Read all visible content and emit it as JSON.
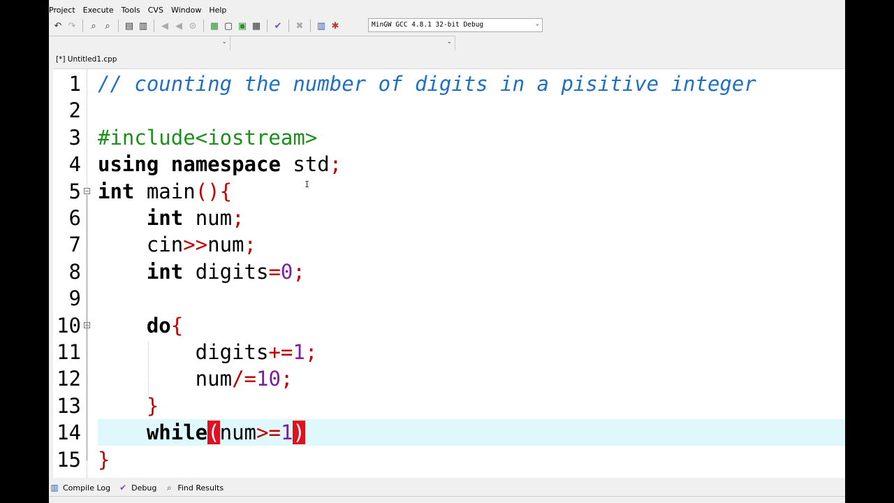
{
  "menu": [
    "Project",
    "Execute",
    "Tools",
    "CVS",
    "Window",
    "Help"
  ],
  "toolbar": {
    "compiler_selected": "MinGW GCC 4.8.1 32-bit Debug"
  },
  "tab": {
    "label": "[*] Untitled1.cpp"
  },
  "editor": {
    "lines": [
      {
        "n": "1",
        "tokens": [
          {
            "t": "// counting the number of digits in a pisitive integer",
            "c": "cm"
          }
        ]
      },
      {
        "n": "2",
        "tokens": []
      },
      {
        "n": "3",
        "tokens": [
          {
            "t": "#include<iostream>",
            "c": "pp"
          }
        ]
      },
      {
        "n": "4",
        "tokens": [
          {
            "t": "using",
            "c": "kw"
          },
          {
            "t": " "
          },
          {
            "t": "namespace",
            "c": "kw"
          },
          {
            "t": " std"
          },
          {
            "t": ";",
            "c": "sym"
          }
        ]
      },
      {
        "n": "5",
        "tokens": [
          {
            "t": "int",
            "c": "kw"
          },
          {
            "t": " main"
          },
          {
            "t": "(){",
            "c": "sym"
          }
        ]
      },
      {
        "n": "6",
        "tokens": [
          {
            "t": "    "
          },
          {
            "t": "int",
            "c": "kw"
          },
          {
            "t": " num"
          },
          {
            "t": ";",
            "c": "sym"
          }
        ]
      },
      {
        "n": "7",
        "tokens": [
          {
            "t": "    cin"
          },
          {
            "t": ">>",
            "c": "sym"
          },
          {
            "t": "num"
          },
          {
            "t": ";",
            "c": "sym"
          }
        ]
      },
      {
        "n": "8",
        "tokens": [
          {
            "t": "    "
          },
          {
            "t": "int",
            "c": "kw"
          },
          {
            "t": " digits"
          },
          {
            "t": "=",
            "c": "sym"
          },
          {
            "t": "0",
            "c": "num"
          },
          {
            "t": ";",
            "c": "sym"
          }
        ]
      },
      {
        "n": "9",
        "tokens": []
      },
      {
        "n": "10",
        "tokens": [
          {
            "t": "    "
          },
          {
            "t": "do",
            "c": "kw"
          },
          {
            "t": "{",
            "c": "sym"
          }
        ]
      },
      {
        "n": "11",
        "tokens": [
          {
            "t": "        digits"
          },
          {
            "t": "+=",
            "c": "sym"
          },
          {
            "t": "1",
            "c": "num"
          },
          {
            "t": ";",
            "c": "sym"
          }
        ]
      },
      {
        "n": "12",
        "tokens": [
          {
            "t": "        num"
          },
          {
            "t": "/=",
            "c": "sym"
          },
          {
            "t": "10",
            "c": "num"
          },
          {
            "t": ";",
            "c": "sym"
          }
        ]
      },
      {
        "n": "13",
        "tokens": [
          {
            "t": "    "
          },
          {
            "t": "}",
            "c": "sym"
          }
        ]
      },
      {
        "n": "14",
        "tokens": [
          {
            "t": "    "
          },
          {
            "t": "while",
            "c": "kw"
          },
          {
            "t": "(",
            "c": "br-hi"
          },
          {
            "t": "num"
          },
          {
            "t": ">=",
            "c": "sym"
          },
          {
            "t": "1",
            "c": "num"
          },
          {
            "t": ")",
            "c": "br-hi"
          }
        ],
        "active": true
      },
      {
        "n": "15",
        "tokens": [
          {
            "t": "}",
            "c": "sym"
          }
        ]
      }
    ]
  },
  "bottom_tabs": [
    {
      "label": "Compile Log",
      "icon": "chart-icon"
    },
    {
      "label": "Debug",
      "icon": "check-icon"
    },
    {
      "label": "Find Results",
      "icon": "find-icon"
    }
  ],
  "colors": {
    "comment": "#1f6fc5",
    "preprocessor": "#1a8f1a",
    "symbol": "#c00000",
    "number": "#7a1fa2",
    "active_line": "#dff8fb",
    "bracket_highlight": "#e01020"
  }
}
